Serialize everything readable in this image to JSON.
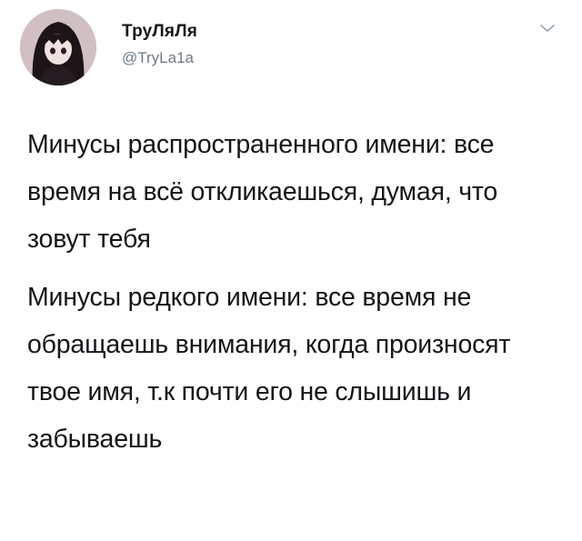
{
  "tweet": {
    "author": {
      "display_name": "ТруЛяЛя",
      "handle": "@TryLa1a"
    },
    "paragraphs": [
      "Минусы распространенного имени: все время на всё откликаешься, думая, что зовут тебя",
      "Минусы редкого имени: все время не обращаешь внимания, когда произносят твое имя, т.к почти его не слышишь и забываешь"
    ],
    "icons": {
      "menu": "chevron-down-icon",
      "avatar": "avatar"
    }
  }
}
